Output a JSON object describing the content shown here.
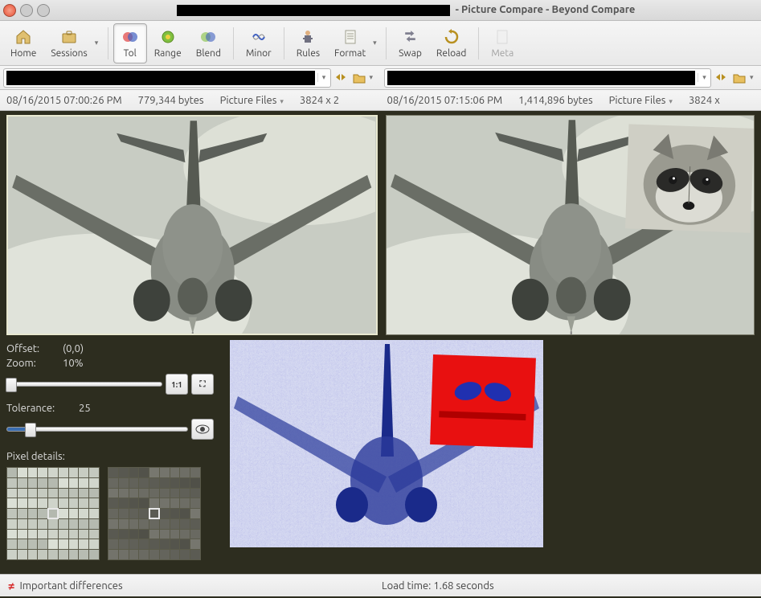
{
  "title": {
    "app": "- Picture Compare - Beyond Compare"
  },
  "toolbar": {
    "home": "Home",
    "sessions": "Sessions",
    "tol": "Tol",
    "range": "Range",
    "blend": "Blend",
    "minor": "Minor",
    "rules": "Rules",
    "format": "Format",
    "swap": "Swap",
    "reload": "Reload",
    "meta": "Meta"
  },
  "info": {
    "left": {
      "date": "08/16/2015 07:00:26 PM",
      "size": "779,344 bytes",
      "type": "Picture Files",
      "dims": "3824 x 2"
    },
    "right": {
      "date": "08/16/2015 07:15:06 PM",
      "size": "1,414,896 bytes",
      "type": "Picture Files",
      "dims": "3824 x"
    }
  },
  "controls": {
    "offset_label": "Offset:",
    "offset_value": "(0,0)",
    "zoom_label": "Zoom:",
    "zoom_value": "10%",
    "tolerance_label": "Tolerance:",
    "tolerance_value": "25",
    "pixel_label": "Pixel details:",
    "btn_11": "1:1",
    "btn_fit": "⛶",
    "btn_eye": "👁"
  },
  "status": {
    "message": "Important differences",
    "loadtime": "Load time: 1.68 seconds"
  }
}
